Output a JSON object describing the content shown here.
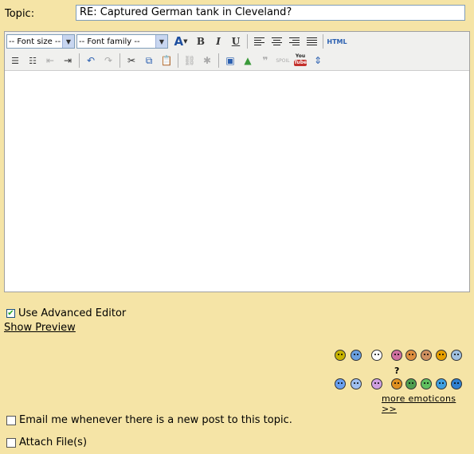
{
  "topic": {
    "label": "Topic:",
    "value": "RE: Captured German tank in Cleveland?"
  },
  "toolbar": {
    "font_size_label": "-- Font size --",
    "font_family_label": "-- Font family --",
    "bold": "B",
    "italic": "I",
    "underline": "U",
    "html": "HTML",
    "youtube_top": "You",
    "youtube_bottom": "Tube"
  },
  "editor": {
    "body": ""
  },
  "options": {
    "advanced_editor": "Use Advanced Editor",
    "advanced_editor_checked": true,
    "show_preview": "Show Preview",
    "email_notify": "Email me whenever there is a new post to this topic.",
    "attach_files": "Attach File(s)"
  },
  "emoticons": {
    "more_label": "more emoticons >>",
    "question_mark": "?",
    "colors": [
      "#c8b400",
      "#6aa0e0",
      "#ffffff",
      "#d070a0",
      "#e09040",
      "#d09060",
      "#e8a000",
      "#a0c0e0",
      "#6aa0f0",
      "#a0c0f0",
      "#d0a0e0",
      "#e09020",
      "#50a050",
      "#60c060",
      "#40a0e0",
      "#3080d0"
    ]
  }
}
